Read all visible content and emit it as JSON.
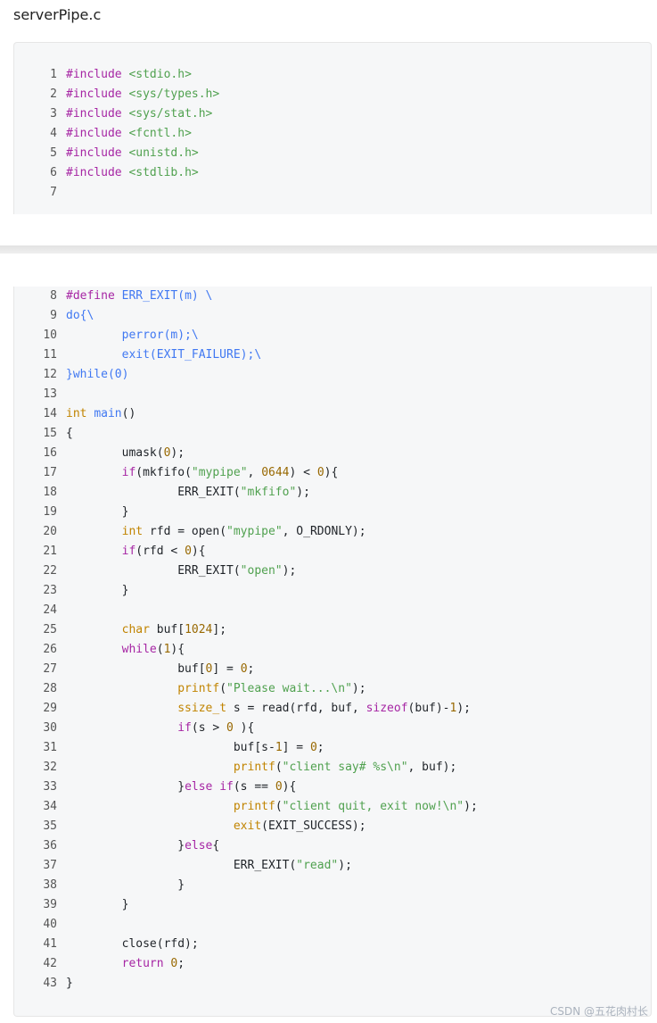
{
  "page": {
    "filename": "serverPipe.c",
    "watermark": "CSDN @五花肉村长"
  },
  "colors": {
    "keyword": "#a626a4",
    "include_path": "#50a14f",
    "macro": "#4078f2",
    "type": "#c18401",
    "string": "#50a14f",
    "number": "#986801",
    "builtin_function": "#c18401",
    "plain": "#1f2328",
    "line_number": "#555555"
  },
  "code_blocks": [
    {
      "lines": [
        {
          "n": "1",
          "tokens": [
            {
              "t": "#include",
              "c": "keyword"
            },
            {
              "t": " ",
              "c": "plain"
            },
            {
              "t": "<stdio.h>",
              "c": "include_path"
            }
          ]
        },
        {
          "n": "2",
          "tokens": [
            {
              "t": "#include",
              "c": "keyword"
            },
            {
              "t": " ",
              "c": "plain"
            },
            {
              "t": "<sys/types.h>",
              "c": "include_path"
            }
          ]
        },
        {
          "n": "3",
          "tokens": [
            {
              "t": "#include",
              "c": "keyword"
            },
            {
              "t": " ",
              "c": "plain"
            },
            {
              "t": "<sys/stat.h>",
              "c": "include_path"
            }
          ]
        },
        {
          "n": "4",
          "tokens": [
            {
              "t": "#include",
              "c": "keyword"
            },
            {
              "t": " ",
              "c": "plain"
            },
            {
              "t": "<fcntl.h>",
              "c": "include_path"
            }
          ]
        },
        {
          "n": "5",
          "tokens": [
            {
              "t": "#include",
              "c": "keyword"
            },
            {
              "t": " ",
              "c": "plain"
            },
            {
              "t": "<unistd.h>",
              "c": "include_path"
            }
          ]
        },
        {
          "n": "6",
          "tokens": [
            {
              "t": "#include",
              "c": "keyword"
            },
            {
              "t": " ",
              "c": "plain"
            },
            {
              "t": "<stdlib.h>",
              "c": "include_path"
            }
          ]
        },
        {
          "n": "7",
          "tokens": []
        }
      ]
    },
    {
      "lines": [
        {
          "n": "8",
          "tokens": [
            {
              "t": "#define",
              "c": "keyword"
            },
            {
              "t": " ERR_EXIT(m) \\",
              "c": "macro"
            }
          ]
        },
        {
          "n": "9",
          "tokens": [
            {
              "t": "do{\\",
              "c": "macro"
            }
          ]
        },
        {
          "n": "10",
          "tokens": [
            {
              "t": "        perror(m);\\",
              "c": "macro"
            }
          ]
        },
        {
          "n": "11",
          "tokens": [
            {
              "t": "        exit(EXIT_FAILURE);\\",
              "c": "macro"
            }
          ]
        },
        {
          "n": "12",
          "tokens": [
            {
              "t": "}while(0)",
              "c": "macro"
            }
          ]
        },
        {
          "n": "13",
          "tokens": []
        },
        {
          "n": "14",
          "tokens": [
            {
              "t": "int",
              "c": "type"
            },
            {
              "t": " ",
              "c": "plain"
            },
            {
              "t": "main",
              "c": "macro"
            },
            {
              "t": "()",
              "c": "plain"
            }
          ]
        },
        {
          "n": "15",
          "tokens": [
            {
              "t": "{",
              "c": "plain"
            }
          ]
        },
        {
          "n": "16",
          "tokens": [
            {
              "t": "        umask(",
              "c": "plain"
            },
            {
              "t": "0",
              "c": "number"
            },
            {
              "t": ");",
              "c": "plain"
            }
          ]
        },
        {
          "n": "17",
          "tokens": [
            {
              "t": "        ",
              "c": "plain"
            },
            {
              "t": "if",
              "c": "keyword"
            },
            {
              "t": "(mkfifo(",
              "c": "plain"
            },
            {
              "t": "\"mypipe\"",
              "c": "string"
            },
            {
              "t": ", ",
              "c": "plain"
            },
            {
              "t": "0644",
              "c": "number"
            },
            {
              "t": ") < ",
              "c": "plain"
            },
            {
              "t": "0",
              "c": "number"
            },
            {
              "t": "){",
              "c": "plain"
            }
          ]
        },
        {
          "n": "18",
          "tokens": [
            {
              "t": "                ERR_EXIT(",
              "c": "plain"
            },
            {
              "t": "\"mkfifo\"",
              "c": "string"
            },
            {
              "t": ");",
              "c": "plain"
            }
          ]
        },
        {
          "n": "19",
          "tokens": [
            {
              "t": "        }",
              "c": "plain"
            }
          ]
        },
        {
          "n": "20",
          "tokens": [
            {
              "t": "        ",
              "c": "plain"
            },
            {
              "t": "int",
              "c": "type"
            },
            {
              "t": " rfd = open(",
              "c": "plain"
            },
            {
              "t": "\"mypipe\"",
              "c": "string"
            },
            {
              "t": ", O_RDONLY);",
              "c": "plain"
            }
          ]
        },
        {
          "n": "21",
          "tokens": [
            {
              "t": "        ",
              "c": "plain"
            },
            {
              "t": "if",
              "c": "keyword"
            },
            {
              "t": "(rfd < ",
              "c": "plain"
            },
            {
              "t": "0",
              "c": "number"
            },
            {
              "t": "){",
              "c": "plain"
            }
          ]
        },
        {
          "n": "22",
          "tokens": [
            {
              "t": "                ERR_EXIT(",
              "c": "plain"
            },
            {
              "t": "\"open\"",
              "c": "string"
            },
            {
              "t": ");",
              "c": "plain"
            }
          ]
        },
        {
          "n": "23",
          "tokens": [
            {
              "t": "        }",
              "c": "plain"
            }
          ]
        },
        {
          "n": "24",
          "tokens": []
        },
        {
          "n": "25",
          "tokens": [
            {
              "t": "        ",
              "c": "plain"
            },
            {
              "t": "char",
              "c": "type"
            },
            {
              "t": " buf[",
              "c": "plain"
            },
            {
              "t": "1024",
              "c": "number"
            },
            {
              "t": "];",
              "c": "plain"
            }
          ]
        },
        {
          "n": "26",
          "tokens": [
            {
              "t": "        ",
              "c": "plain"
            },
            {
              "t": "while",
              "c": "keyword"
            },
            {
              "t": "(",
              "c": "plain"
            },
            {
              "t": "1",
              "c": "number"
            },
            {
              "t": "){",
              "c": "plain"
            }
          ]
        },
        {
          "n": "27",
          "tokens": [
            {
              "t": "                buf[",
              "c": "plain"
            },
            {
              "t": "0",
              "c": "number"
            },
            {
              "t": "] = ",
              "c": "plain"
            },
            {
              "t": "0",
              "c": "number"
            },
            {
              "t": ";",
              "c": "plain"
            }
          ]
        },
        {
          "n": "28",
          "tokens": [
            {
              "t": "                ",
              "c": "plain"
            },
            {
              "t": "printf",
              "c": "builtin_function"
            },
            {
              "t": "(",
              "c": "plain"
            },
            {
              "t": "\"Please wait...\\n\"",
              "c": "string"
            },
            {
              "t": ");",
              "c": "plain"
            }
          ]
        },
        {
          "n": "29",
          "tokens": [
            {
              "t": "                ",
              "c": "plain"
            },
            {
              "t": "ssize_t",
              "c": "type"
            },
            {
              "t": " s = read(rfd, buf, ",
              "c": "plain"
            },
            {
              "t": "sizeof",
              "c": "keyword"
            },
            {
              "t": "(buf)-",
              "c": "plain"
            },
            {
              "t": "1",
              "c": "number"
            },
            {
              "t": ");",
              "c": "plain"
            }
          ]
        },
        {
          "n": "30",
          "tokens": [
            {
              "t": "                ",
              "c": "plain"
            },
            {
              "t": "if",
              "c": "keyword"
            },
            {
              "t": "(s > ",
              "c": "plain"
            },
            {
              "t": "0",
              "c": "number"
            },
            {
              "t": " ){",
              "c": "plain"
            }
          ]
        },
        {
          "n": "31",
          "tokens": [
            {
              "t": "                        buf[s-",
              "c": "plain"
            },
            {
              "t": "1",
              "c": "number"
            },
            {
              "t": "] = ",
              "c": "plain"
            },
            {
              "t": "0",
              "c": "number"
            },
            {
              "t": ";",
              "c": "plain"
            }
          ]
        },
        {
          "n": "32",
          "tokens": [
            {
              "t": "                        ",
              "c": "plain"
            },
            {
              "t": "printf",
              "c": "builtin_function"
            },
            {
              "t": "(",
              "c": "plain"
            },
            {
              "t": "\"client say# %s\\n\"",
              "c": "string"
            },
            {
              "t": ", buf);",
              "c": "plain"
            }
          ]
        },
        {
          "n": "33",
          "tokens": [
            {
              "t": "                }",
              "c": "plain"
            },
            {
              "t": "else",
              "c": "keyword"
            },
            {
              "t": " ",
              "c": "plain"
            },
            {
              "t": "if",
              "c": "keyword"
            },
            {
              "t": "(s == ",
              "c": "plain"
            },
            {
              "t": "0",
              "c": "number"
            },
            {
              "t": "){",
              "c": "plain"
            }
          ]
        },
        {
          "n": "34",
          "tokens": [
            {
              "t": "                        ",
              "c": "plain"
            },
            {
              "t": "printf",
              "c": "builtin_function"
            },
            {
              "t": "(",
              "c": "plain"
            },
            {
              "t": "\"client quit, exit now!\\n\"",
              "c": "string"
            },
            {
              "t": ");",
              "c": "plain"
            }
          ]
        },
        {
          "n": "35",
          "tokens": [
            {
              "t": "                        ",
              "c": "plain"
            },
            {
              "t": "exit",
              "c": "builtin_function"
            },
            {
              "t": "(EXIT_SUCCESS);",
              "c": "plain"
            }
          ]
        },
        {
          "n": "36",
          "tokens": [
            {
              "t": "                }",
              "c": "plain"
            },
            {
              "t": "else",
              "c": "keyword"
            },
            {
              "t": "{",
              "c": "plain"
            }
          ]
        },
        {
          "n": "37",
          "tokens": [
            {
              "t": "                        ERR_EXIT(",
              "c": "plain"
            },
            {
              "t": "\"read\"",
              "c": "string"
            },
            {
              "t": ");",
              "c": "plain"
            }
          ]
        },
        {
          "n": "38",
          "tokens": [
            {
              "t": "                }",
              "c": "plain"
            }
          ]
        },
        {
          "n": "39",
          "tokens": [
            {
              "t": "        }",
              "c": "plain"
            }
          ]
        },
        {
          "n": "40",
          "tokens": []
        },
        {
          "n": "41",
          "tokens": [
            {
              "t": "        close(rfd);",
              "c": "plain"
            }
          ]
        },
        {
          "n": "42",
          "tokens": [
            {
              "t": "        ",
              "c": "plain"
            },
            {
              "t": "return",
              "c": "keyword"
            },
            {
              "t": " ",
              "c": "plain"
            },
            {
              "t": "0",
              "c": "number"
            },
            {
              "t": ";",
              "c": "plain"
            }
          ]
        },
        {
          "n": "43",
          "tokens": [
            {
              "t": "}",
              "c": "plain"
            }
          ]
        }
      ]
    }
  ]
}
